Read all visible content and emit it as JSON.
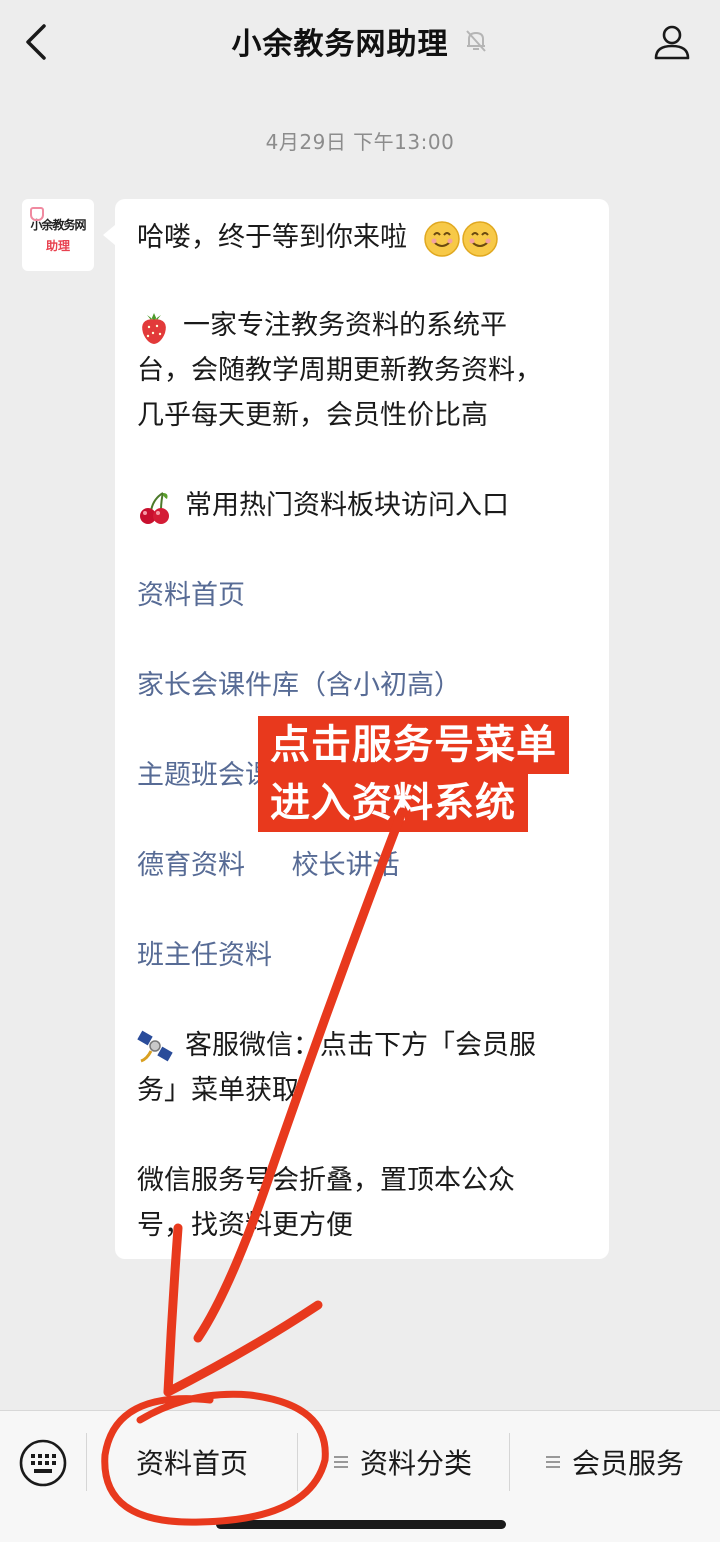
{
  "header": {
    "title": "小余教务网助理",
    "back_icon": "chevron-left-icon",
    "mute_icon": "bell-muted-icon",
    "profile_icon": "person-icon"
  },
  "chat": {
    "timestamp": "4月29日 下午13:00",
    "avatar": {
      "line1": "小余教务网",
      "line2": "助理"
    },
    "message": {
      "greeting": "哈喽，终于等到你来啦",
      "intro_line1": "一家专注教务资料的系统平",
      "intro_line2": "台，会随教学周期更新教务资料，",
      "intro_line3": "几乎每天更新，会员性价比高",
      "entry_heading": "常用热门资料板块访问入口",
      "links": {
        "home": "资料首页",
        "parent_meeting": "家长会课件库（含小初高）",
        "theme_class": "主题班会课件库（含小初高）",
        "moral": "德育资料",
        "principal": "校长讲话",
        "head_teacher": "班主任资料"
      },
      "service_line1": "客服微信：点击下方「会员服",
      "service_line2": "务」菜单获取",
      "pin_line1": "微信服务号会折叠，置顶本公众",
      "pin_line2": "号，找资料更方便"
    }
  },
  "annotation": {
    "line1": "点击服务号菜单",
    "line2": "进入资料系统",
    "color": "#e8391d"
  },
  "menu": {
    "keyboard_icon": "keyboard-icon",
    "items": [
      "资料首页",
      "资料分类",
      "会员服务"
    ]
  },
  "colors": {
    "background": "#ededed",
    "link": "#576b95",
    "bubble": "#ffffff"
  }
}
